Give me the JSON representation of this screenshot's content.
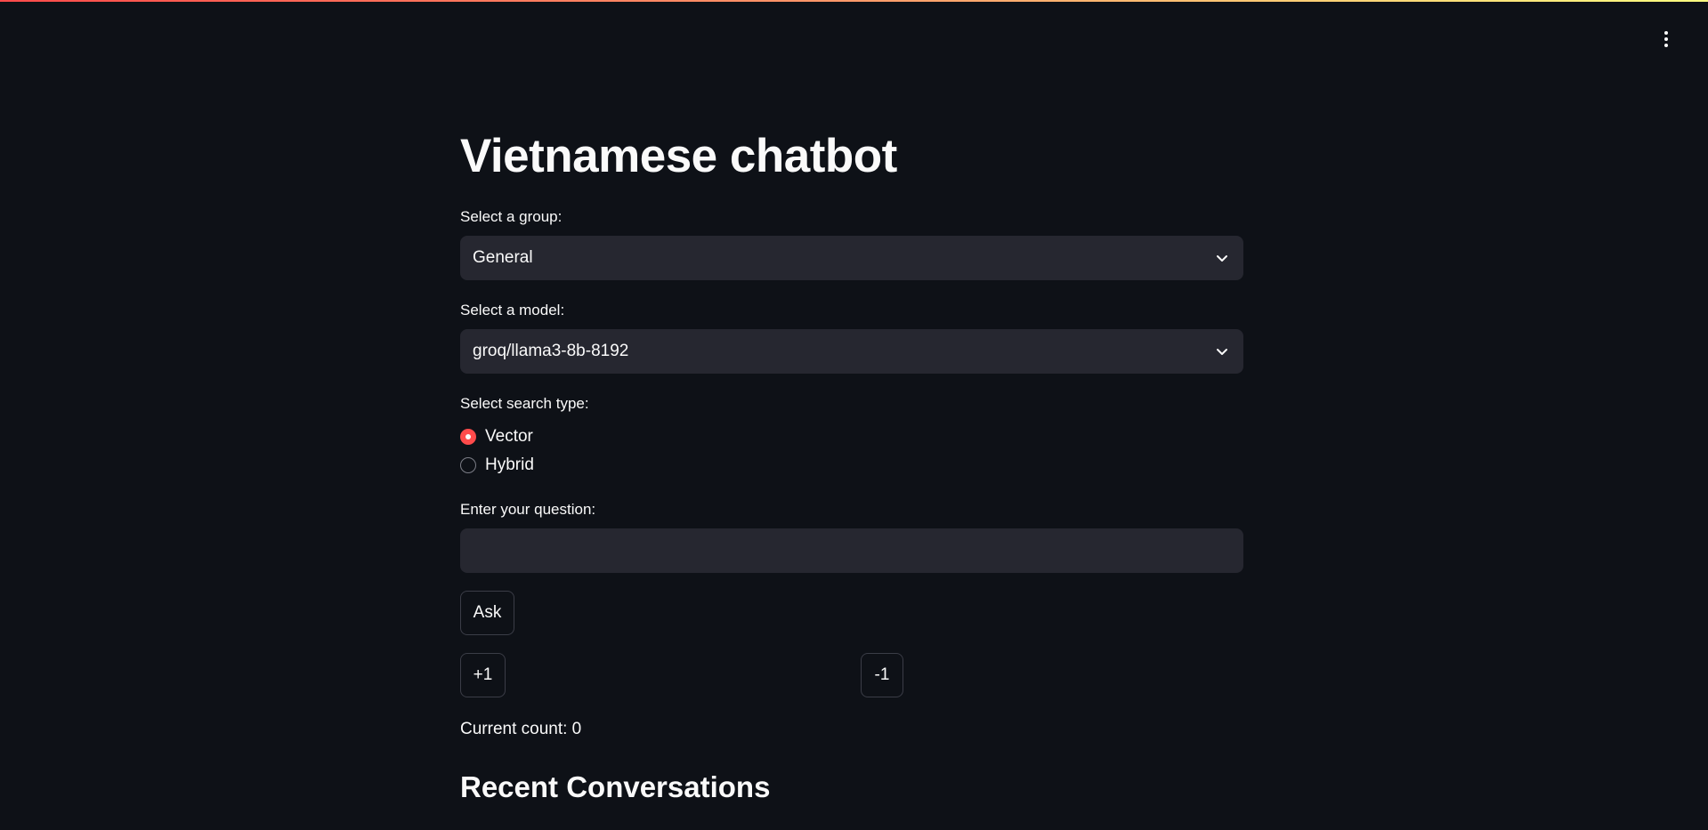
{
  "app": {
    "title": "Vietnamese chatbot",
    "accent_color": "#ff4b4b",
    "background_color": "#0e1117",
    "widget_color": "#262730"
  },
  "menu": {
    "icon": "vertical-ellipsis-icon"
  },
  "group_select": {
    "label": "Select a group:",
    "value": "General",
    "icon": "chevron-down-icon"
  },
  "model_select": {
    "label": "Select a model:",
    "value": "groq/llama3-8b-8192",
    "icon": "chevron-down-icon"
  },
  "search_type": {
    "label": "Select search type:",
    "options": [
      {
        "label": "Vector",
        "selected": true
      },
      {
        "label": "Hybrid",
        "selected": false
      }
    ]
  },
  "question": {
    "label": "Enter your question:",
    "value": "",
    "placeholder": ""
  },
  "buttons": {
    "ask": "Ask",
    "plus_one": "+1",
    "minus_one": "-1"
  },
  "counter": {
    "text": "Current count: 0"
  },
  "recent": {
    "heading": "Recent Conversations"
  }
}
